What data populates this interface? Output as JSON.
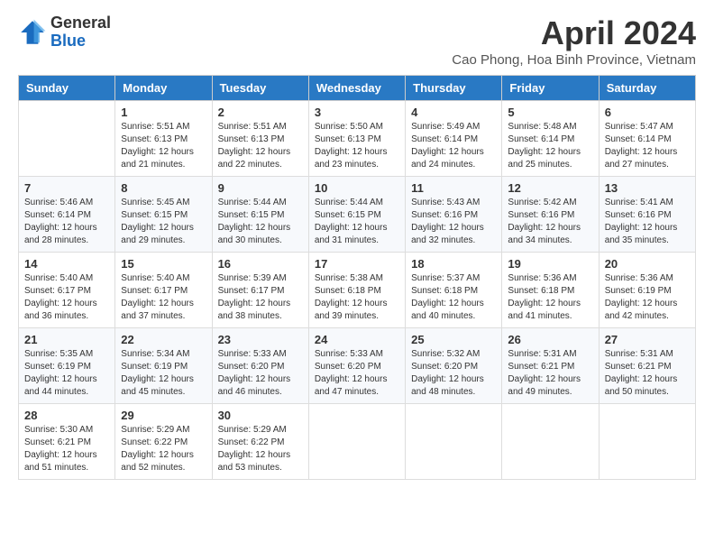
{
  "header": {
    "logo_general": "General",
    "logo_blue": "Blue",
    "month_year": "April 2024",
    "location": "Cao Phong, Hoa Binh Province, Vietnam"
  },
  "days_of_week": [
    "Sunday",
    "Monday",
    "Tuesday",
    "Wednesday",
    "Thursday",
    "Friday",
    "Saturday"
  ],
  "weeks": [
    [
      {
        "day": "",
        "sunrise": "",
        "sunset": "",
        "daylight": ""
      },
      {
        "day": "1",
        "sunrise": "Sunrise: 5:51 AM",
        "sunset": "Sunset: 6:13 PM",
        "daylight": "Daylight: 12 hours and 21 minutes."
      },
      {
        "day": "2",
        "sunrise": "Sunrise: 5:51 AM",
        "sunset": "Sunset: 6:13 PM",
        "daylight": "Daylight: 12 hours and 22 minutes."
      },
      {
        "day": "3",
        "sunrise": "Sunrise: 5:50 AM",
        "sunset": "Sunset: 6:13 PM",
        "daylight": "Daylight: 12 hours and 23 minutes."
      },
      {
        "day": "4",
        "sunrise": "Sunrise: 5:49 AM",
        "sunset": "Sunset: 6:14 PM",
        "daylight": "Daylight: 12 hours and 24 minutes."
      },
      {
        "day": "5",
        "sunrise": "Sunrise: 5:48 AM",
        "sunset": "Sunset: 6:14 PM",
        "daylight": "Daylight: 12 hours and 25 minutes."
      },
      {
        "day": "6",
        "sunrise": "Sunrise: 5:47 AM",
        "sunset": "Sunset: 6:14 PM",
        "daylight": "Daylight: 12 hours and 27 minutes."
      }
    ],
    [
      {
        "day": "7",
        "sunrise": "Sunrise: 5:46 AM",
        "sunset": "Sunset: 6:14 PM",
        "daylight": "Daylight: 12 hours and 28 minutes."
      },
      {
        "day": "8",
        "sunrise": "Sunrise: 5:45 AM",
        "sunset": "Sunset: 6:15 PM",
        "daylight": "Daylight: 12 hours and 29 minutes."
      },
      {
        "day": "9",
        "sunrise": "Sunrise: 5:44 AM",
        "sunset": "Sunset: 6:15 PM",
        "daylight": "Daylight: 12 hours and 30 minutes."
      },
      {
        "day": "10",
        "sunrise": "Sunrise: 5:44 AM",
        "sunset": "Sunset: 6:15 PM",
        "daylight": "Daylight: 12 hours and 31 minutes."
      },
      {
        "day": "11",
        "sunrise": "Sunrise: 5:43 AM",
        "sunset": "Sunset: 6:16 PM",
        "daylight": "Daylight: 12 hours and 32 minutes."
      },
      {
        "day": "12",
        "sunrise": "Sunrise: 5:42 AM",
        "sunset": "Sunset: 6:16 PM",
        "daylight": "Daylight: 12 hours and 34 minutes."
      },
      {
        "day": "13",
        "sunrise": "Sunrise: 5:41 AM",
        "sunset": "Sunset: 6:16 PM",
        "daylight": "Daylight: 12 hours and 35 minutes."
      }
    ],
    [
      {
        "day": "14",
        "sunrise": "Sunrise: 5:40 AM",
        "sunset": "Sunset: 6:17 PM",
        "daylight": "Daylight: 12 hours and 36 minutes."
      },
      {
        "day": "15",
        "sunrise": "Sunrise: 5:40 AM",
        "sunset": "Sunset: 6:17 PM",
        "daylight": "Daylight: 12 hours and 37 minutes."
      },
      {
        "day": "16",
        "sunrise": "Sunrise: 5:39 AM",
        "sunset": "Sunset: 6:17 PM",
        "daylight": "Daylight: 12 hours and 38 minutes."
      },
      {
        "day": "17",
        "sunrise": "Sunrise: 5:38 AM",
        "sunset": "Sunset: 6:18 PM",
        "daylight": "Daylight: 12 hours and 39 minutes."
      },
      {
        "day": "18",
        "sunrise": "Sunrise: 5:37 AM",
        "sunset": "Sunset: 6:18 PM",
        "daylight": "Daylight: 12 hours and 40 minutes."
      },
      {
        "day": "19",
        "sunrise": "Sunrise: 5:36 AM",
        "sunset": "Sunset: 6:18 PM",
        "daylight": "Daylight: 12 hours and 41 minutes."
      },
      {
        "day": "20",
        "sunrise": "Sunrise: 5:36 AM",
        "sunset": "Sunset: 6:19 PM",
        "daylight": "Daylight: 12 hours and 42 minutes."
      }
    ],
    [
      {
        "day": "21",
        "sunrise": "Sunrise: 5:35 AM",
        "sunset": "Sunset: 6:19 PM",
        "daylight": "Daylight: 12 hours and 44 minutes."
      },
      {
        "day": "22",
        "sunrise": "Sunrise: 5:34 AM",
        "sunset": "Sunset: 6:19 PM",
        "daylight": "Daylight: 12 hours and 45 minutes."
      },
      {
        "day": "23",
        "sunrise": "Sunrise: 5:33 AM",
        "sunset": "Sunset: 6:20 PM",
        "daylight": "Daylight: 12 hours and 46 minutes."
      },
      {
        "day": "24",
        "sunrise": "Sunrise: 5:33 AM",
        "sunset": "Sunset: 6:20 PM",
        "daylight": "Daylight: 12 hours and 47 minutes."
      },
      {
        "day": "25",
        "sunrise": "Sunrise: 5:32 AM",
        "sunset": "Sunset: 6:20 PM",
        "daylight": "Daylight: 12 hours and 48 minutes."
      },
      {
        "day": "26",
        "sunrise": "Sunrise: 5:31 AM",
        "sunset": "Sunset: 6:21 PM",
        "daylight": "Daylight: 12 hours and 49 minutes."
      },
      {
        "day": "27",
        "sunrise": "Sunrise: 5:31 AM",
        "sunset": "Sunset: 6:21 PM",
        "daylight": "Daylight: 12 hours and 50 minutes."
      }
    ],
    [
      {
        "day": "28",
        "sunrise": "Sunrise: 5:30 AM",
        "sunset": "Sunset: 6:21 PM",
        "daylight": "Daylight: 12 hours and 51 minutes."
      },
      {
        "day": "29",
        "sunrise": "Sunrise: 5:29 AM",
        "sunset": "Sunset: 6:22 PM",
        "daylight": "Daylight: 12 hours and 52 minutes."
      },
      {
        "day": "30",
        "sunrise": "Sunrise: 5:29 AM",
        "sunset": "Sunset: 6:22 PM",
        "daylight": "Daylight: 12 hours and 53 minutes."
      },
      {
        "day": "",
        "sunrise": "",
        "sunset": "",
        "daylight": ""
      },
      {
        "day": "",
        "sunrise": "",
        "sunset": "",
        "daylight": ""
      },
      {
        "day": "",
        "sunrise": "",
        "sunset": "",
        "daylight": ""
      },
      {
        "day": "",
        "sunrise": "",
        "sunset": "",
        "daylight": ""
      }
    ]
  ]
}
